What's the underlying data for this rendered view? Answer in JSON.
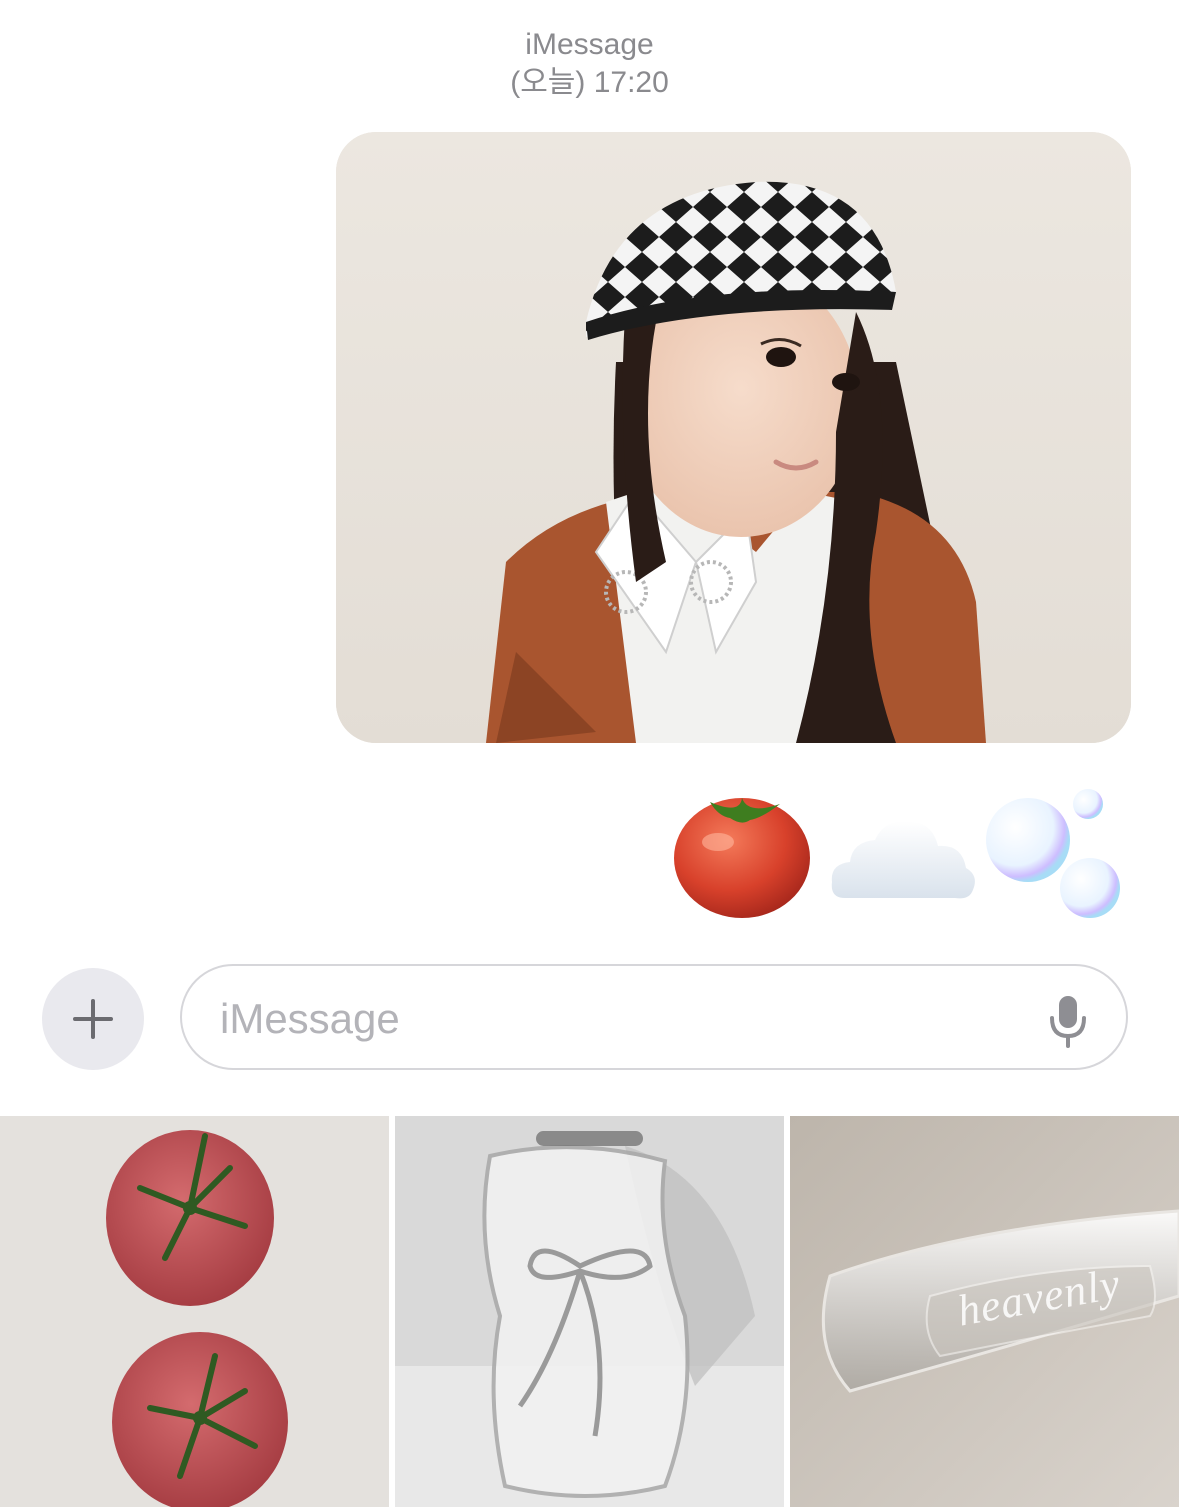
{
  "header": {
    "service": "iMessage",
    "timestamp": "(오늘) 17:20"
  },
  "message": {
    "photo_alt": "photo of a girl wearing a black and white patterned cap",
    "emojis": [
      "tomato-icon",
      "cloud-icon",
      "bubbles-icon"
    ]
  },
  "composer": {
    "placeholder": "iMessage",
    "add_icon": "plus-icon",
    "mic_icon": "microphone-icon"
  },
  "gallery": {
    "items": [
      {
        "name": "tomatoes"
      },
      {
        "name": "glass-vase"
      },
      {
        "name": "glass-object",
        "engraving": "heavenly"
      }
    ]
  },
  "colors": {
    "secondary_text": "#8a8a8e",
    "input_border": "#d6d6da",
    "plus_button_bg": "#e9e9ee"
  }
}
